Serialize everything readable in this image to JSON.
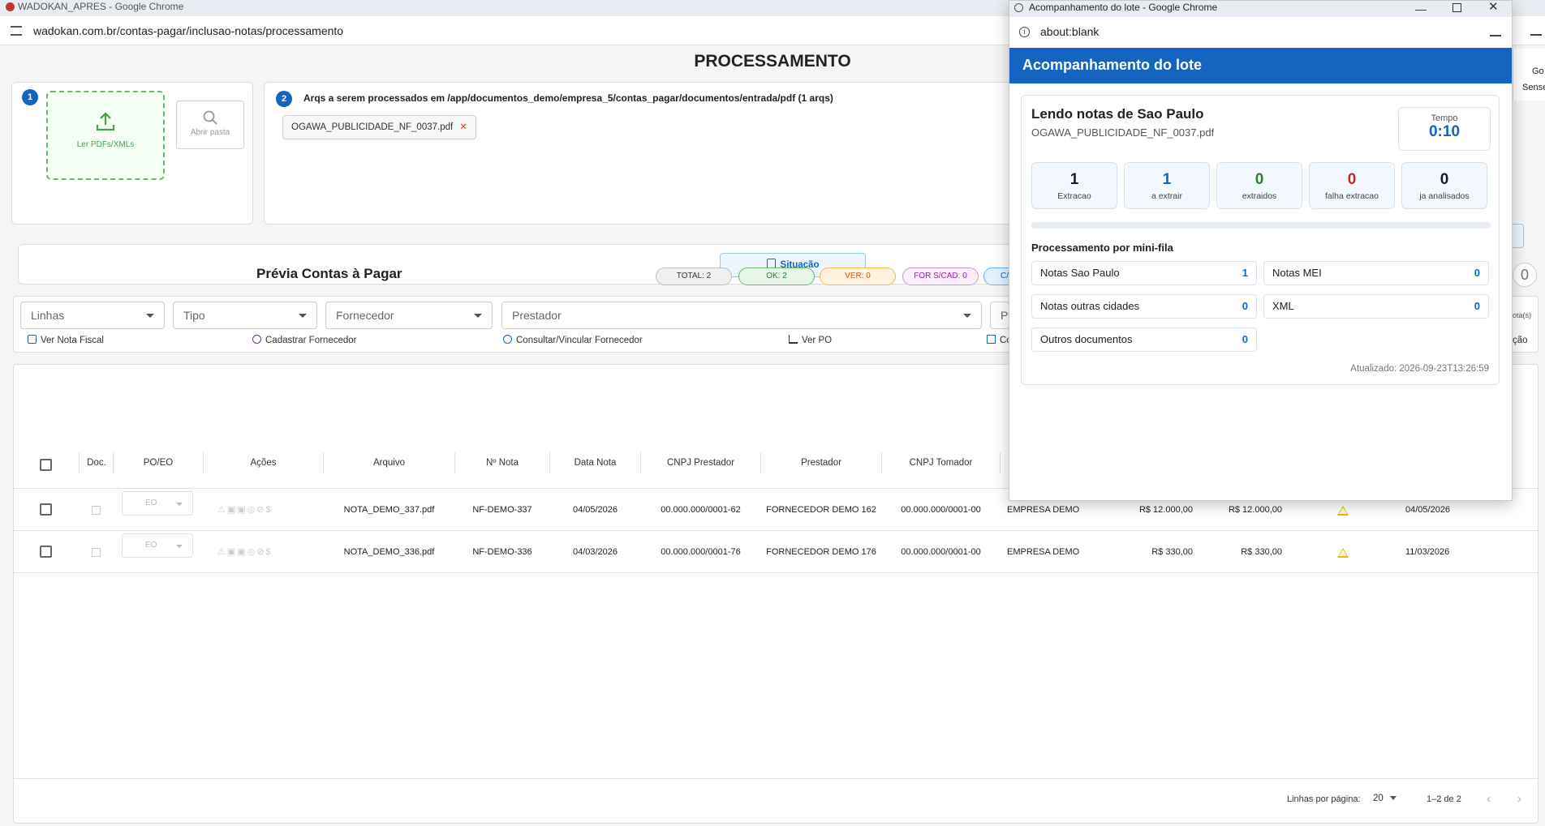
{
  "main_window": {
    "title": "WADOKAN_APRES - Google Chrome",
    "url": "wadokan.com.br/contas-pagar/inclusao-notas/processamento"
  },
  "page": {
    "title": "PROCESSAMENTO",
    "step1": {
      "badge": "1",
      "upload_label": "Ler PDFs/XMLs",
      "folder_label": "Abrir pasta"
    },
    "step2": {
      "badge": "2",
      "path_text": "Arqs a serem processados em /app/documentos_demo/empresa_5/contas_pagar/documentos/entrada/pdf (1 arqs)",
      "files": [
        "OGAWA_PUBLICIDADE_NF_0037.pdf"
      ]
    },
    "situacao_button": "Situação",
    "preview": {
      "title": "Prévia Contas à Pagar",
      "badges": [
        {
          "label": "TOTAL: 2",
          "bg": "#f0f0f0",
          "border": "#bdbdbd",
          "color": "#333333"
        },
        {
          "label": "OK: 2",
          "bg": "#e8f5e9",
          "border": "#66bb6a",
          "color": "#2e7d32"
        },
        {
          "label": "VER: 0",
          "bg": "#fff3e0",
          "border": "#ffb74d",
          "color": "#e65100"
        },
        {
          "label": "FOR S/CAD: 0",
          "bg": "#fdeefb",
          "border": "#ce93d8",
          "color": "#8e24aa"
        },
        {
          "label": "C/",
          "bg": "#e3f2fd",
          "border": "#64b5f6",
          "color": "#1565c0"
        }
      ],
      "right_counter": "0",
      "right_text_top": "ota(s)",
      "right_text_bottom": "ção"
    },
    "filters": {
      "linhas": "Linhas",
      "tipo": "Tipo",
      "fornecedor": "Fornecedor",
      "prestador": "Prestador",
      "extra": "P"
    },
    "actions": {
      "ver_nota_fiscal": "Ver Nota Fiscal",
      "cadastrar_fornecedor": "Cadastrar Fornecedor",
      "consultar_vincular": "Consultar/Vincular Fornecedor",
      "ver_po": "Ver PO",
      "co": "Co"
    },
    "table": {
      "headers": [
        "Doc.",
        "PO/EO",
        "Ações",
        "Arquivo",
        "Nº Nota",
        "Data Nota",
        "CNPJ Prestador",
        "Prestador",
        "CNPJ Tomador"
      ],
      "rows": [
        {
          "eo": "EO",
          "arquivo": "NOTA_DEMO_337.pdf",
          "nota": "NF-DEMO-337",
          "data": "04/05/2026",
          "cnpj_prestador": "00.000.000/0001-62",
          "prestador": "FORNECEDOR DEMO 162",
          "cnpj_tomador": "00.000.000/0001-00",
          "tomador": "EMPRESA DEMO",
          "valor1": "R$ 12.000,00",
          "valor2": "R$ 12.000,00",
          "data2": "04/05/2026"
        },
        {
          "eo": "EO",
          "arquivo": "NOTA_DEMO_336.pdf",
          "nota": "NF-DEMO-336",
          "data": "04/03/2026",
          "cnpj_prestador": "00.000.000/0001-76",
          "prestador": "FORNECEDOR DEMO 176",
          "cnpj_tomador": "00.000.000/0001-00",
          "tomador": "EMPRESA DEMO",
          "valor1": "R$ 330,00",
          "valor2": "R$ 330,00",
          "data2": "11/03/2026"
        }
      ]
    },
    "pagination": {
      "label": "Linhas por página:",
      "per_page": "20",
      "range": "1–2 de 2"
    },
    "right_edge_text1": "Go",
    "right_edge_text2": "Sense"
  },
  "popup": {
    "title": "Acompanhamento do lote - Google Chrome",
    "url": "about:blank",
    "header": "Acompanhamento do lote",
    "status_title": "Lendo notas de Sao Paulo",
    "status_file": "OGAWA_PUBLICIDADE_NF_0037.pdf",
    "tempo_label": "Tempo",
    "tempo_value": "0:10",
    "stats": [
      {
        "value": "1",
        "label": "Extracao",
        "color": "#1a1a2e"
      },
      {
        "value": "1",
        "label": "a extrair",
        "color": "#1565c0"
      },
      {
        "value": "0",
        "label": "extraidos",
        "color": "#2e7d32"
      },
      {
        "value": "0",
        "label": "falha extracao",
        "color": "#c62828"
      },
      {
        "value": "0",
        "label": "ja analisados",
        "color": "#1a1a2e"
      }
    ],
    "progress_fraction": 0,
    "queue_title": "Processamento por mini-fila",
    "queue": [
      {
        "label": "Notas Sao Paulo",
        "value": "1"
      },
      {
        "label": "Notas MEI",
        "value": "0"
      },
      {
        "label": "Notas outras cidades",
        "value": "0"
      },
      {
        "label": "XML",
        "value": "0"
      },
      {
        "label": "Outros documentos",
        "value": "0"
      }
    ],
    "updated": "Atualizado: 2026-09-23T13:26:59"
  }
}
